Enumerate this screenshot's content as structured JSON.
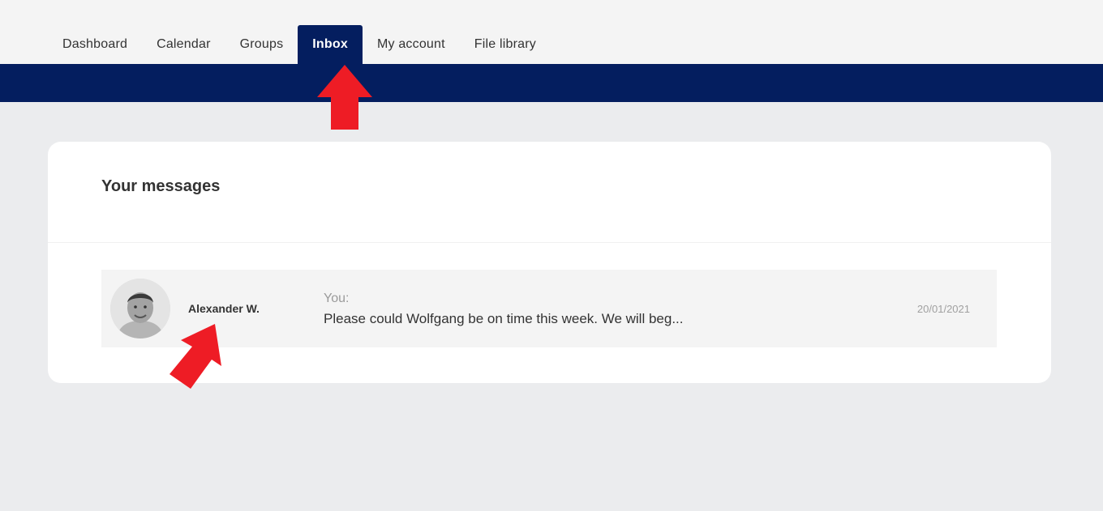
{
  "nav": {
    "tabs": [
      {
        "label": "Dashboard"
      },
      {
        "label": "Calendar"
      },
      {
        "label": "Groups"
      },
      {
        "label": "Inbox"
      },
      {
        "label": "My account"
      },
      {
        "label": "File library"
      }
    ],
    "active_tab": "Inbox"
  },
  "messages": {
    "title": "Your messages",
    "items": [
      {
        "sender": "Alexander W.",
        "from_label": "You:",
        "preview": "Please could Wolfgang be on time this week. We will beg...",
        "date": "20/01/2021",
        "avatar_icon": "person-avatar"
      }
    ]
  },
  "annotations": {
    "arrow_color": "#ee1c25",
    "arrows": [
      "up-arrow-icon",
      "diagonal-arrow-icon"
    ]
  },
  "colors": {
    "brand_navy": "#041e5f",
    "page_bg": "#ebecee",
    "row_bg": "#f4f4f4"
  }
}
